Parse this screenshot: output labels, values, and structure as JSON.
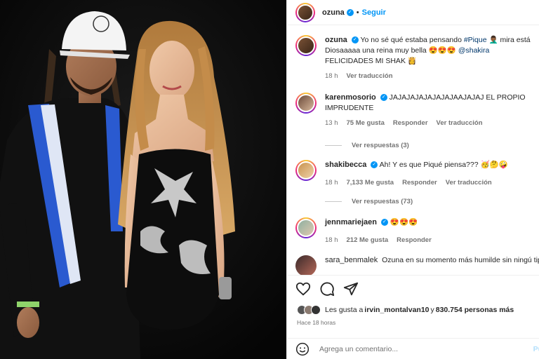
{
  "header": {
    "username": "ozuna",
    "separator": "•",
    "follow_label": "Seguir"
  },
  "comments": [
    {
      "username": "ozuna",
      "text_before": "Yo no sé qué estaba pensando ",
      "hashtag": "#Pique",
      "text_mid": " 🤦🏾‍♂️ mira está Diosaaaaa una reina muy bella 😍😍😍 ",
      "mention": "@shakira",
      "text_after": " FELICIDADES MI SHAK 👸",
      "time": "18 h",
      "action": "Ver traducción"
    },
    {
      "username": "karenmosorio",
      "text": "JAJAJAJAJAJAJAJAAJAJAJ EL PROPIO IMPRUDENTE",
      "time": "13 h",
      "likes": "75 Me gusta",
      "reply": "Responder",
      "translate": "Ver traducción",
      "view_replies": "Ver respuestas (3)"
    },
    {
      "username": "shakibecca",
      "text": "Ah! Y es que Piqué piensa??? 🥳🤔🤪",
      "time": "18 h",
      "likes": "7,133 Me gusta",
      "reply": "Responder",
      "translate": "Ver traducción",
      "view_replies": "Ver respuestas (73)"
    },
    {
      "username": "jennmariejaen",
      "text": "😍😍😍",
      "time": "18 h",
      "likes": "212 Me gusta",
      "reply": "Responder"
    },
    {
      "username": "sara_benmalek",
      "text": "Ozuna en su momento más humilde sin ningú tipo de filtro en el san🥹"
    }
  ],
  "actions": {
    "liked_by_prefix": "Les gusta a ",
    "liked_by_user": "irvin_montalvan10",
    "liked_by_mid": " y ",
    "liked_by_count": "830.754 personas más",
    "time_ago": "Hace 18 horas"
  },
  "comment_box": {
    "placeholder": "Agrega un comentario...",
    "post_label": "Pu"
  },
  "icons": [
    "heart-icon",
    "comment-icon",
    "share-icon",
    "smiley-icon",
    "verified-icon"
  ],
  "colors": {
    "accent_blue": "#0095f6",
    "link_blue": "#00376b",
    "muted_gray": "#737373",
    "photo_background": "#0a0a0a"
  }
}
